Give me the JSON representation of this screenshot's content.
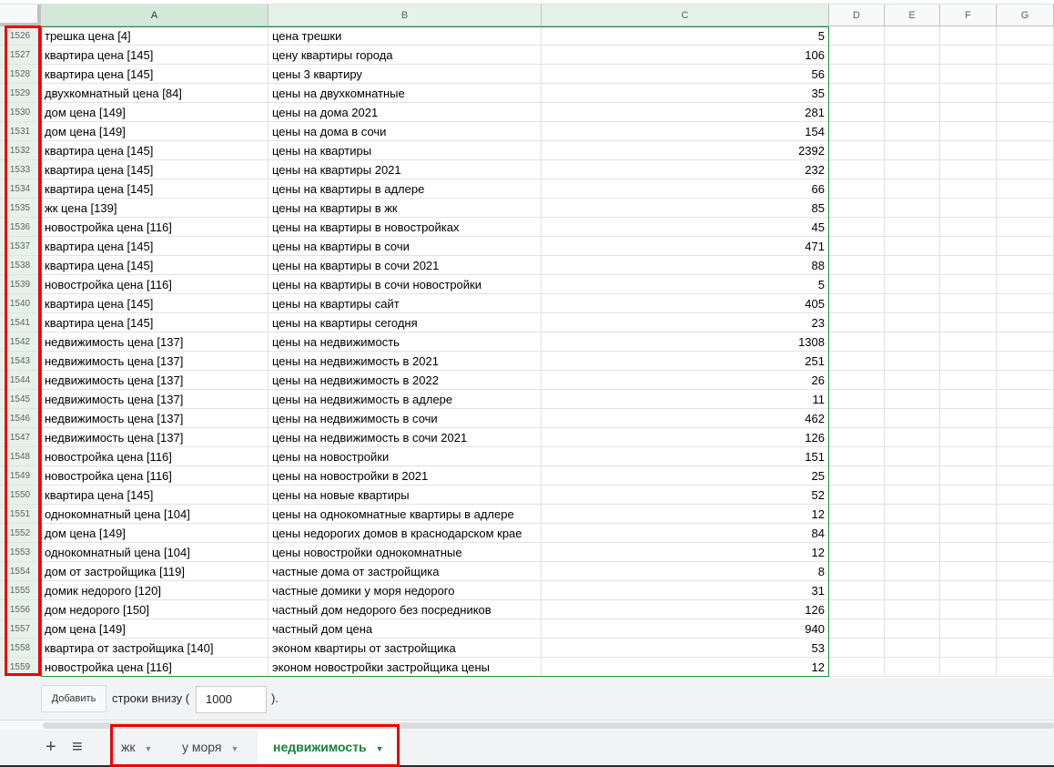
{
  "columns": [
    "A",
    "B",
    "C",
    "D",
    "E",
    "F",
    "G"
  ],
  "rows": [
    [
      "1526",
      "трешка цена [4]",
      "цена трешки",
      "5"
    ],
    [
      "1527",
      "квартира цена [145]",
      "цену квартиры города",
      "106"
    ],
    [
      "1528",
      "квартира цена [145]",
      "цены 3 квартиру",
      "56"
    ],
    [
      "1529",
      "двухкомнатный цена [84]",
      "цены на двухкомнатные",
      "35"
    ],
    [
      "1530",
      "дом цена [149]",
      "цены на дома 2021",
      "281"
    ],
    [
      "1531",
      "дом цена [149]",
      "цены на дома в сочи",
      "154"
    ],
    [
      "1532",
      "квартира цена [145]",
      "цены на квартиры",
      "2392"
    ],
    [
      "1533",
      "квартира цена [145]",
      "цены на квартиры 2021",
      "232"
    ],
    [
      "1534",
      "квартира цена [145]",
      "цены на квартиры в адлере",
      "66"
    ],
    [
      "1535",
      "жк цена [139]",
      "цены на квартиры в жк",
      "85"
    ],
    [
      "1536",
      "новостройка цена [116]",
      "цены на квартиры в новостройках",
      "45"
    ],
    [
      "1537",
      "квартира цена [145]",
      "цены на квартиры в сочи",
      "471"
    ],
    [
      "1538",
      "квартира цена [145]",
      "цены на квартиры в сочи 2021",
      "88"
    ],
    [
      "1539",
      "новостройка цена [116]",
      "цены на квартиры в сочи новостройки",
      "5"
    ],
    [
      "1540",
      "квартира цена [145]",
      "цены на квартиры сайт",
      "405"
    ],
    [
      "1541",
      "квартира цена [145]",
      "цены на квартиры сегодня",
      "23"
    ],
    [
      "1542",
      "недвижимость цена [137]",
      "цены на недвижимость",
      "1308"
    ],
    [
      "1543",
      "недвижимость цена [137]",
      "цены на недвижимость в 2021",
      "251"
    ],
    [
      "1544",
      "недвижимость цена [137]",
      "цены на недвижимость в 2022",
      "26"
    ],
    [
      "1545",
      "недвижимость цена [137]",
      "цены на недвижимость в адлере",
      "11"
    ],
    [
      "1546",
      "недвижимость цена [137]",
      "цены на недвижимость в сочи",
      "462"
    ],
    [
      "1547",
      "недвижимость цена [137]",
      "цены на недвижимость в сочи 2021",
      "126"
    ],
    [
      "1548",
      "новостройка цена [116]",
      "цены на новостройки",
      "151"
    ],
    [
      "1549",
      "новостройка цена [116]",
      "цены на новостройки в 2021",
      "25"
    ],
    [
      "1550",
      "квартира цена [145]",
      "цены на новые квартиры",
      "52"
    ],
    [
      "1551",
      "однокомнатный цена [104]",
      "цены на однокомнатные квартиры в адлере",
      "12"
    ],
    [
      "1552",
      "дом цена [149]",
      "цены недорогих домов в краснодарском крае",
      "84"
    ],
    [
      "1553",
      "однокомнатный цена [104]",
      "цены новостройки однокомнатные",
      "12"
    ],
    [
      "1554",
      "дом от застройщика [119]",
      "частные дома от застройщика",
      "8"
    ],
    [
      "1555",
      "домик недорого [120]",
      "частные домики у моря недорого",
      "31"
    ],
    [
      "1556",
      "дом недорого [150]",
      "частный дом недорого без посредников",
      "126"
    ],
    [
      "1557",
      "дом цена [149]",
      "частный дом цена",
      "940"
    ],
    [
      "1558",
      "квартира от застройщика [140]",
      "эконом квартиры от застройщика",
      "53"
    ],
    [
      "1559",
      "новостройка цена [116]",
      "эконом новостройки застройщика цены",
      "12"
    ]
  ],
  "footer": {
    "add_button": "Добавить",
    "text": "строки внизу (",
    "count": "1000",
    "end": ")."
  },
  "sheet_tabs": [
    {
      "label": "жк"
    },
    {
      "label": "у моря"
    },
    {
      "label": "недвижимость",
      "active": true
    }
  ],
  "icons": {
    "add_sheet": "+",
    "all_sheets": "≡",
    "dropdown": "▼"
  }
}
